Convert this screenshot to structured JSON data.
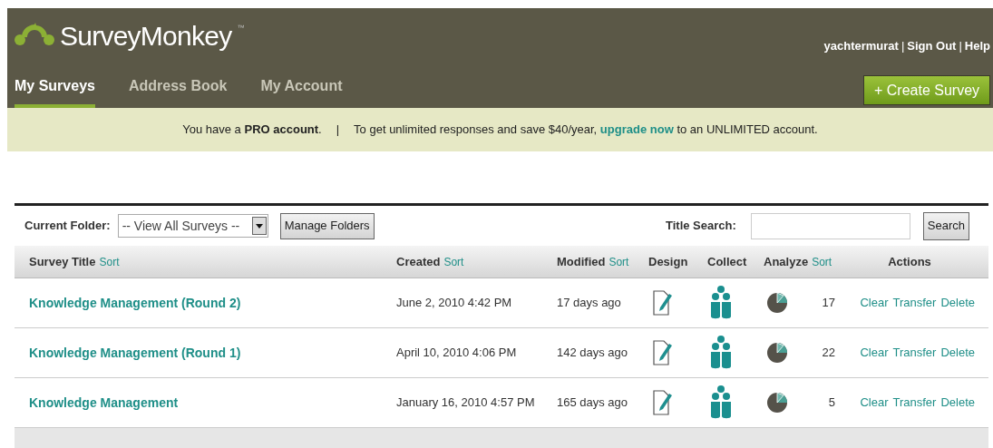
{
  "header": {
    "logo_text": "SurveyMonkey",
    "trademark": "™",
    "user_menu": [
      {
        "kind": "link",
        "text": "yachtermurat"
      },
      {
        "kind": "separator",
        "text": "|"
      },
      {
        "kind": "link",
        "text": "Sign Out"
      },
      {
        "kind": "separator",
        "text": "|"
      },
      {
        "kind": "link",
        "text": "Help"
      }
    ],
    "tabs": [
      {
        "label": "My Surveys",
        "selected": true
      },
      {
        "label": "Address Book",
        "selected": false
      },
      {
        "label": "My Account",
        "selected": false
      }
    ],
    "create_button": "+ Create Survey"
  },
  "banner": {
    "notice": "You have a **PRO account**.",
    "separator": "|",
    "promo_before": "To get unlimited responses and save $40/year,",
    "promo_link": "upgrade now",
    "promo_after": "to an UNLIMITED account."
  },
  "toolbar": {
    "folder_label": "Current Folder:",
    "folder_value": "-- View All Surveys --",
    "manage_button": "Manage Folders",
    "search_label": "Title Search:",
    "search_button": "Search"
  },
  "table": {
    "columns": [
      {
        "label": "Survey Title",
        "sort": "Sort"
      },
      {
        "label": "Created",
        "sort": "Sort"
      },
      {
        "label": "Modified",
        "sort": "Sort"
      },
      {
        "label": "Design"
      },
      {
        "label": "Collect"
      },
      {
        "label": "Analyze",
        "sort": "Sort"
      },
      {
        "label": "Actions"
      }
    ],
    "rows": [
      {
        "title": "Knowledge Management (Round 2)",
        "created": "June 2, 2010 4:42 PM",
        "modified": "17 days ago",
        "responses": "17",
        "actions": [
          "Clear",
          "Transfer",
          "Delete"
        ]
      },
      {
        "title": "Knowledge Management (Round 1)",
        "created": "April 10, 2010 4:06 PM",
        "modified": "142 days ago",
        "responses": "22",
        "actions": [
          "Clear",
          "Transfer",
          "Delete"
        ]
      },
      {
        "title": "Knowledge Management",
        "created": "January 16, 2010 4:57 PM",
        "modified": "165 days ago",
        "responses": "5",
        "actions": [
          "Clear",
          "Transfer",
          "Delete"
        ]
      }
    ]
  }
}
